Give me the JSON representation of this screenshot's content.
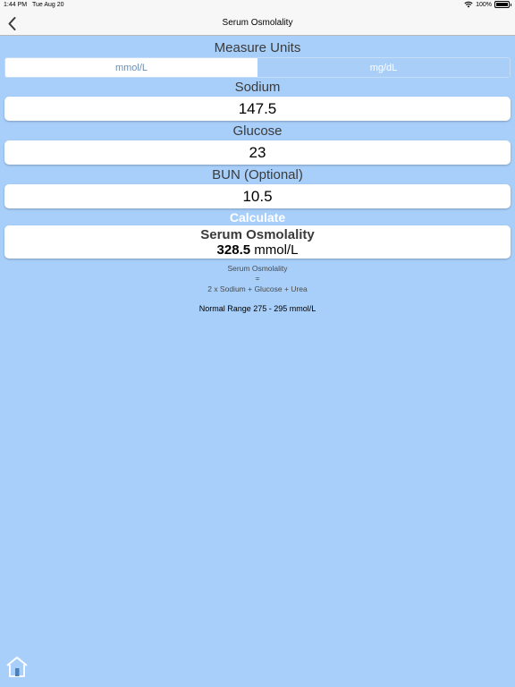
{
  "status_bar": {
    "time": "1:44 PM",
    "date": "Tue Aug 20",
    "battery": "100%"
  },
  "nav": {
    "title": "Serum Osmolality"
  },
  "units": {
    "label": "Measure Units",
    "options": [
      "mmol/L",
      "mg/dL"
    ],
    "selected": "mmol/L"
  },
  "sodium": {
    "label": "Sodium",
    "value": "147.5"
  },
  "glucose": {
    "label": "Glucose",
    "value": "23"
  },
  "bun": {
    "label": "BUN (Optional)",
    "value": "10.5"
  },
  "calculate_label": "Calculate",
  "result": {
    "title": "Serum Osmolality",
    "value": "328.5",
    "unit": "mmol/L"
  },
  "formula": {
    "line1": "Serum Osmolality",
    "line2": "=",
    "line3": "2 x Sodium + Glucose + Urea"
  },
  "normal_range": "Normal Range 275 - 295 mmol/L",
  "colors": {
    "background": "#a8cffa",
    "bar": "#f7f7f7",
    "accent": "#6c8fb5"
  },
  "icons": {
    "back": "chevron-left-icon",
    "home": "home-icon",
    "wifi": "wifi-icon",
    "battery": "battery-icon"
  }
}
